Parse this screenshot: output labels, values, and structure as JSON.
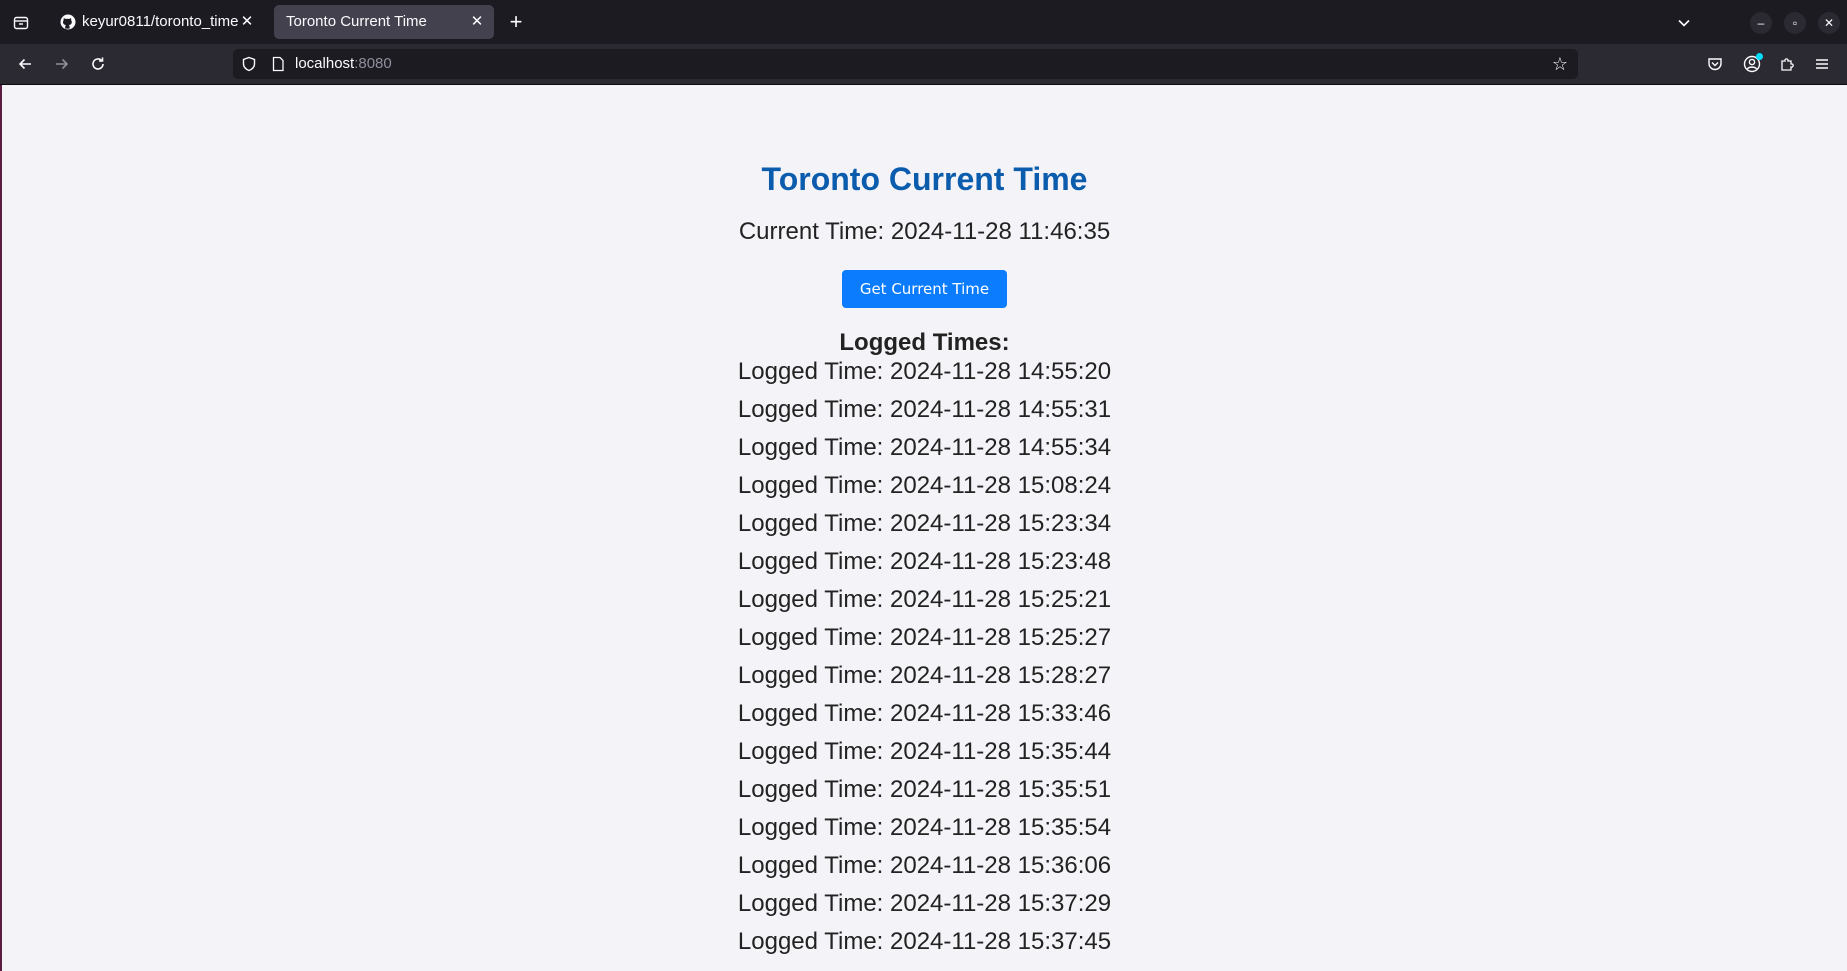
{
  "browser": {
    "tabs": [
      {
        "title": "keyur0811/toronto_time",
        "favicon": "github-icon",
        "active": false
      },
      {
        "title": "Toronto Current Time",
        "active": true
      }
    ],
    "url_host": "localhost",
    "url_port": ":8080"
  },
  "page": {
    "title": "Toronto Current Time",
    "current_time": "Current Time: 2024-11-28 11:46:35",
    "button_label": "Get Current Time",
    "logged_heading": "Logged Times:",
    "logged_times": [
      "Logged Time: 2024-11-28 14:55:20",
      "Logged Time: 2024-11-28 14:55:31",
      "Logged Time: 2024-11-28 14:55:34",
      "Logged Time: 2024-11-28 15:08:24",
      "Logged Time: 2024-11-28 15:23:34",
      "Logged Time: 2024-11-28 15:23:48",
      "Logged Time: 2024-11-28 15:25:21",
      "Logged Time: 2024-11-28 15:25:27",
      "Logged Time: 2024-11-28 15:28:27",
      "Logged Time: 2024-11-28 15:33:46",
      "Logged Time: 2024-11-28 15:35:44",
      "Logged Time: 2024-11-28 15:35:51",
      "Logged Time: 2024-11-28 15:35:54",
      "Logged Time: 2024-11-28 15:36:06",
      "Logged Time: 2024-11-28 15:37:29",
      "Logged Time: 2024-11-28 15:37:45"
    ]
  },
  "colors": {
    "title": "#0b5cad",
    "button": "#0a7cfd",
    "page_bg": "#f4f4f8"
  }
}
